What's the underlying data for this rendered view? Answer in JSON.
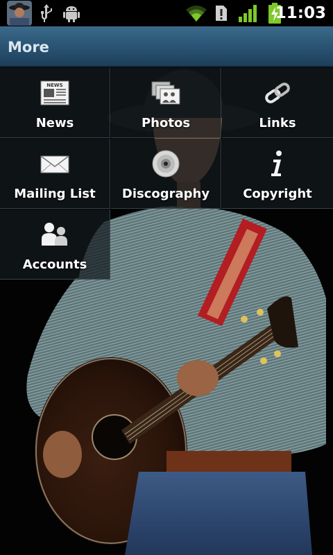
{
  "status_bar": {
    "time": "11:03",
    "icons": [
      "avatar-thumbnail",
      "usb-icon",
      "android-debug-icon",
      "wifi-icon",
      "alert-icon",
      "signal-icon",
      "battery-charging-icon"
    ]
  },
  "title_bar": {
    "title": "More"
  },
  "menu": {
    "items": [
      {
        "label": "News",
        "icon": "newspaper-icon"
      },
      {
        "label": "Photos",
        "icon": "photos-icon"
      },
      {
        "label": "Links",
        "icon": "chain-link-icon"
      },
      {
        "label": "Mailing List",
        "icon": "envelope-icon"
      },
      {
        "label": "Discography",
        "icon": "cd-disc-icon"
      },
      {
        "label": "Copyright",
        "icon": "info-icon"
      },
      {
        "label": "Accounts",
        "icon": "people-icon"
      }
    ]
  },
  "colors": {
    "title_bar": "#2b5676",
    "tile_bg": "#141a1e",
    "label": "#ffffff",
    "battery_green": "#7ec82a",
    "wifi_green": "#7ec82a"
  }
}
